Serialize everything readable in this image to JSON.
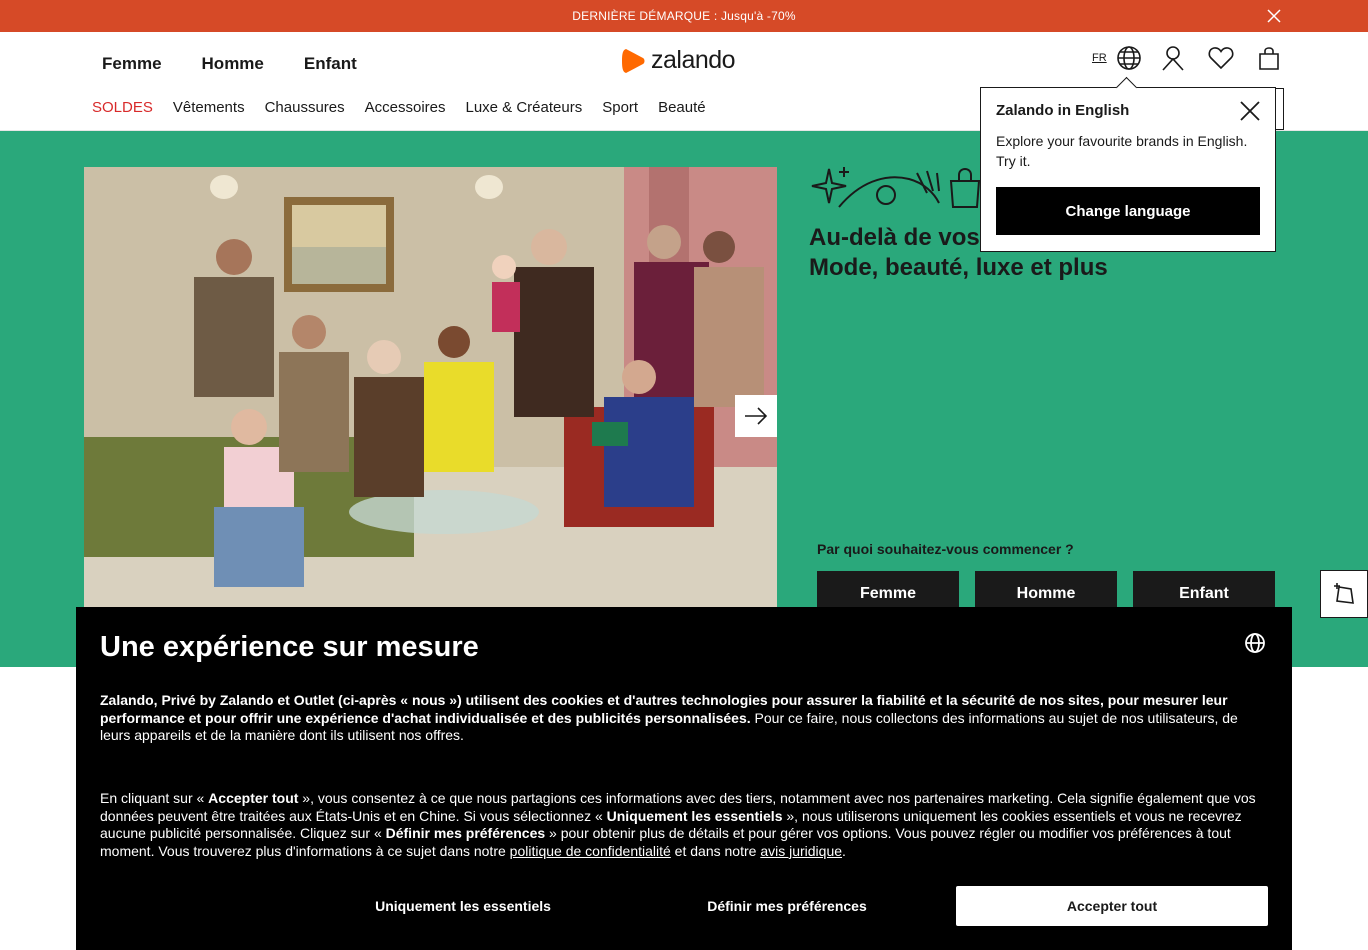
{
  "promo": {
    "text": "DERNIÈRE DÉMARQUE : Jusqu'à -70%"
  },
  "header": {
    "gender_nav": [
      "Femme",
      "Homme",
      "Enfant"
    ],
    "logo": "zalando",
    "lang_code": "FR",
    "categories": [
      {
        "label": "SOLDES",
        "color": "#d82a2a"
      },
      {
        "label": "Vêtements"
      },
      {
        "label": "Chaussures"
      },
      {
        "label": "Accessoires"
      },
      {
        "label": "Luxe & Créateurs"
      },
      {
        "label": "Sport"
      },
      {
        "label": "Beauté"
      }
    ]
  },
  "hero": {
    "title_line1": "Au-delà de vos",
    "title_line2": "Mode, beauté, luxe et plus",
    "start_question": "Par quoi souhaitez-vous commencer ?",
    "start_buttons": [
      "Femme",
      "Homme",
      "Enfant"
    ],
    "background": "#2aa87b"
  },
  "language_popover": {
    "title": "Zalando in English",
    "body": "Explore your favourite brands in English. Try it.",
    "button": "Change language"
  },
  "cookie": {
    "title": "Une expérience sur mesure",
    "p1_bold": "Zalando, Privé by Zalando et Outlet (ci-après « nous ») utilisent des cookies et d'autres technologies pour assurer la fiabilité et la sécurité de nos sites, pour mesurer leur performance et pour offrir une expérience d'achat individualisée et des publicités personnalisées.",
    "p1_rest": " Pour ce faire, nous collectons des informations au sujet de nos utilisateurs, de leurs appareils et de la manière dont ils utilisent nos offres.",
    "p2": {
      "t1": "En cliquant sur « ",
      "b1": "Accepter tout",
      "t2": " », vous consentez à ce que nous partagions ces informations avec des tiers, notamment avec nos partenaires marketing. Cela signifie également que vos données peuvent être traitées aux États-Unis et en Chine. Si vous sélectionnez « ",
      "b2": "Uniquement les essentiels",
      "t3": " », nous utiliserons uniquement les cookies essentiels et vous ne recevrez aucune publicité personnalisée. Cliquez sur « ",
      "b3": "Définir mes préférences",
      "t4": " » pour obtenir plus de détails et pour gérer vos options. Vous pouvez régler ou modifier vos préférences à tout moment. Vous trouverez plus d'informations à ce sujet dans notre ",
      "link1": "politique de confidentialité",
      "t5": " et dans notre ",
      "link2": "avis juridique",
      "t6": "."
    },
    "buttons": {
      "essentials": "Uniquement les essentiels",
      "preferences": "Définir mes préférences",
      "accept_all": "Accepter tout"
    }
  },
  "icons": [
    "close-icon",
    "globe-icon",
    "user-icon",
    "heart-icon",
    "bag-icon",
    "arrow-right-icon",
    "sparkle-icon"
  ]
}
